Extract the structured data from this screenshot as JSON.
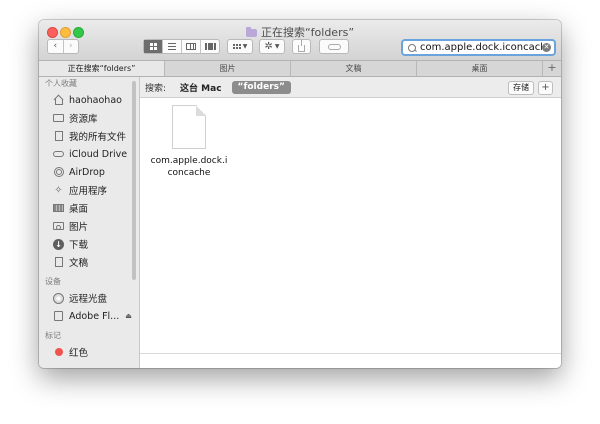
{
  "window": {
    "title": "正在搜索“folders”"
  },
  "toolbar": {
    "back": "‹",
    "forward": "›",
    "search_value": "com.apple.dock.iconcache",
    "clear": "✕"
  },
  "tabs": [
    {
      "label": "正在搜索“folders”",
      "active": true
    },
    {
      "label": "图片"
    },
    {
      "label": "文稿"
    },
    {
      "label": "桌面"
    }
  ],
  "tab_add": "+",
  "sidebar": {
    "favorites_header": "个人收藏",
    "favorites": [
      {
        "label": "haohaohao",
        "icon": "home-icon"
      },
      {
        "label": "资源库",
        "icon": "folder-icon"
      },
      {
        "label": "我的所有文件",
        "icon": "document-icon"
      },
      {
        "label": "iCloud Drive",
        "icon": "cloud-icon"
      },
      {
        "label": "AirDrop",
        "icon": "airdrop-icon"
      },
      {
        "label": "应用程序",
        "icon": "applications-icon"
      },
      {
        "label": "桌面",
        "icon": "desktop-icon"
      },
      {
        "label": "图片",
        "icon": "camera-icon"
      },
      {
        "label": "下载",
        "icon": "download-icon"
      },
      {
        "label": "文稿",
        "icon": "documents-icon"
      }
    ],
    "devices_header": "设备",
    "devices": [
      {
        "label": "远程光盘",
        "icon": "disc-icon"
      },
      {
        "label": "Adobe Fl...",
        "icon": "drive-icon",
        "eject": "⏏"
      }
    ],
    "tags_header": "标记",
    "tags": [
      {
        "label": "红色",
        "color": "#f0534e"
      }
    ]
  },
  "scopebar": {
    "label": "搜索:",
    "scope_mac": "这台 Mac",
    "scope_folders": "“folders”",
    "save": "存储",
    "add": "+"
  },
  "results": [
    {
      "name": "com.apple.dock.iconcache"
    }
  ]
}
